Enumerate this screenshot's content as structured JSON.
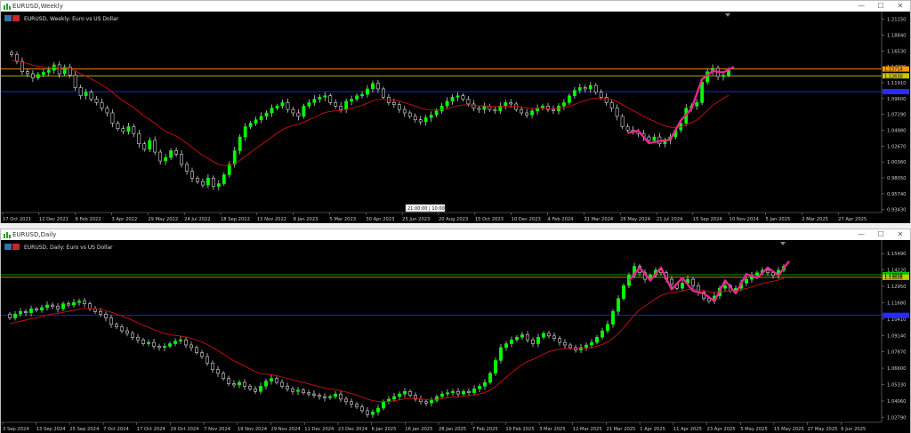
{
  "windows": [
    {
      "title": "EURUSD,Weekly",
      "min_btn": "—",
      "max_btn": "☐",
      "close_btn": "✕",
      "icon": "chart-window-icon"
    },
    {
      "title": "EURUSD,Daily",
      "min_btn": "—",
      "max_btn": "☐",
      "close_btn": "✕",
      "icon": "chart-window-icon"
    }
  ],
  "chart_data": [
    {
      "type": "candlestick",
      "symbol_label": "EURUSD, Weekly: Euro vs US Dollar",
      "ylim": [
        0.93,
        1.22
      ],
      "y_ticks": [
        "1.21150",
        "1.18840",
        "1.16530",
        "1.14220",
        "1.11910",
        "1.09600",
        "1.07290",
        "1.04980",
        "1.02670",
        "1.00360",
        "0.98050",
        "0.95740",
        "0.93430"
      ],
      "x_ticks": [
        "17 Oct 2021",
        "12 Dec 2021",
        "6 Feb 2022",
        "3 Apr 2022",
        "29 May 2022",
        "24 Jul 2022",
        "18 Sep 2022",
        "13 Nov 2022",
        "8 Jan 2023",
        "5 Mar 2023",
        "30 Apr 2023",
        "25 Jun 2023",
        "20 Aug 2023",
        "15 Oct 2023",
        "10 Dec 2023",
        "4 Feb 2024",
        "31 Mar 2024",
        "26 May 2024",
        "21 Jul 2024",
        "15 Sep 2024",
        "10 Nov 2024",
        "5 Jan 2025",
        "2 Mar 2025",
        "27 Apr 2025"
      ],
      "crosshair_label": "21:00:00 | 10:00",
      "price_labels": [
        "1.13714",
        "1.12630"
      ],
      "horizontal_lines": [
        {
          "value": 1.139,
          "color": "#ff9900"
        },
        {
          "value": 1.129,
          "color": "#c8c800"
        },
        {
          "value": 1.106,
          "color": "#2a2aff"
        }
      ],
      "closes": [
        1.16,
        1.15,
        1.135,
        1.132,
        1.126,
        1.131,
        1.134,
        1.137,
        1.145,
        1.132,
        1.142,
        1.13,
        1.112,
        1.1,
        1.105,
        1.095,
        1.09,
        1.082,
        1.075,
        1.06,
        1.052,
        1.048,
        1.055,
        1.045,
        1.03,
        1.022,
        1.035,
        1.018,
        1.005,
        1.01,
        1.02,
        1.015,
        1.0,
        0.99,
        0.98,
        0.975,
        0.97,
        0.98,
        0.968,
        0.972,
        0.985,
        1.0,
        1.02,
        1.04,
        1.055,
        1.06,
        1.065,
        1.07,
        1.075,
        1.082,
        1.085,
        1.09,
        1.08,
        1.075,
        1.07,
        1.085,
        1.09,
        1.095,
        1.098,
        1.1,
        1.09,
        1.085,
        1.08,
        1.092,
        1.095,
        1.1,
        1.102,
        1.11,
        1.118,
        1.11,
        1.098,
        1.09,
        1.087,
        1.08,
        1.075,
        1.07,
        1.065,
        1.062,
        1.068,
        1.072,
        1.078,
        1.085,
        1.092,
        1.098,
        1.1,
        1.095,
        1.088,
        1.082,
        1.08,
        1.085,
        1.08,
        1.078,
        1.085,
        1.09,
        1.088,
        1.08,
        1.075,
        1.072,
        1.078,
        1.082,
        1.085,
        1.08,
        1.078,
        1.085,
        1.09,
        1.1,
        1.108,
        1.112,
        1.11,
        1.115,
        1.105,
        1.098,
        1.09,
        1.082,
        1.07,
        1.055,
        1.05,
        1.048,
        1.045,
        1.04,
        1.035,
        1.04,
        1.03,
        1.035,
        1.04,
        1.05,
        1.06,
        1.082,
        1.085,
        1.09,
        1.12,
        1.135,
        1.14,
        1.128,
        1.13,
        1.138
      ],
      "ma_start": 1.15,
      "pattern_color": "#e8288c"
    },
    {
      "type": "candlestick",
      "symbol_label": "EURUSD, Daily: Euro vs US Dollar",
      "ylim": [
        1.024,
        1.164
      ],
      "y_ticks": [
        "1.15490",
        "1.14220",
        "1.12950",
        "1.11680",
        "1.10410",
        "1.09140",
        "1.07870",
        "1.06600",
        "1.05330",
        "1.04060",
        "1.02790"
      ],
      "x_ticks": [
        "3 Sep 2024",
        "13 Sep 2024",
        "25 Sep 2024",
        "7 Oct 2024",
        "17 Oct 2024",
        "29 Oct 2024",
        "7 Nov 2024",
        "19 Nov 2024",
        "29 Nov 2024",
        "11 Dec 2024",
        "23 Dec 2024",
        "6 Jan 2025",
        "16 Jan 2025",
        "28 Jan 2025",
        "7 Feb 2025",
        "19 Feb 2025",
        "3 Mar 2025",
        "12 Mar 2025",
        "21 Mar 2025",
        "1 Apr 2025",
        "11 Apr 2025",
        "23 Apr 2025",
        "5 May 2025",
        "15 May 2025",
        "27 May 2025",
        "6 Jun 2025"
      ],
      "price_labels": [
        "1.13808",
        "1.13608"
      ],
      "horizontal_lines": [
        {
          "value": 1.1385,
          "color": "#00c800"
        },
        {
          "value": 1.1365,
          "color": "#c8c800"
        },
        {
          "value": 1.107,
          "color": "#2a2aff"
        }
      ],
      "closes": [
        1.105,
        1.108,
        1.11,
        1.109,
        1.112,
        1.111,
        1.113,
        1.115,
        1.114,
        1.112,
        1.116,
        1.115,
        1.117,
        1.118,
        1.116,
        1.112,
        1.11,
        1.108,
        1.105,
        1.1,
        1.098,
        1.095,
        1.093,
        1.09,
        1.088,
        1.085,
        1.086,
        1.083,
        1.082,
        1.083,
        1.085,
        1.087,
        1.088,
        1.084,
        1.082,
        1.078,
        1.075,
        1.07,
        1.065,
        1.062,
        1.058,
        1.054,
        1.053,
        1.055,
        1.052,
        1.05,
        1.048,
        1.052,
        1.056,
        1.058,
        1.055,
        1.052,
        1.05,
        1.048,
        1.049,
        1.047,
        1.046,
        1.045,
        1.044,
        1.043,
        1.044,
        1.046,
        1.042,
        1.04,
        1.038,
        1.036,
        1.033,
        1.03,
        1.032,
        1.035,
        1.04,
        1.042,
        1.044,
        1.046,
        1.048,
        1.045,
        1.042,
        1.04,
        1.039,
        1.041,
        1.044,
        1.046,
        1.047,
        1.048,
        1.046,
        1.048,
        1.047,
        1.05,
        1.052,
        1.055,
        1.062,
        1.072,
        1.082,
        1.085,
        1.088,
        1.09,
        1.092,
        1.088,
        1.085,
        1.09,
        1.093,
        1.091,
        1.089,
        1.086,
        1.084,
        1.082,
        1.08,
        1.082,
        1.084,
        1.086,
        1.09,
        1.095,
        1.1,
        1.11,
        1.12,
        1.13,
        1.138,
        1.145,
        1.14,
        1.135,
        1.138,
        1.142,
        1.14,
        1.135,
        1.131,
        1.128,
        1.132,
        1.135,
        1.13,
        1.125,
        1.12,
        1.118,
        1.122,
        1.128,
        1.13,
        1.126,
        1.128,
        1.132,
        1.135,
        1.138,
        1.14,
        1.142,
        1.14,
        1.138,
        1.142,
        1.145
      ],
      "ma_start": 1.1,
      "pattern_color": "#e8288c"
    }
  ]
}
